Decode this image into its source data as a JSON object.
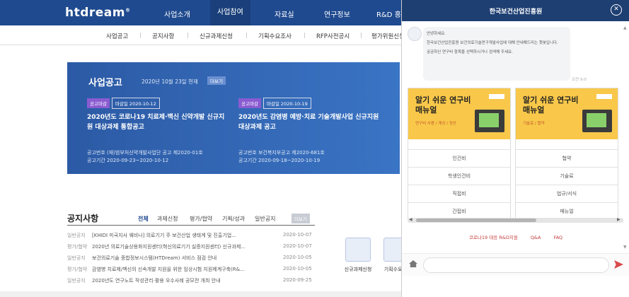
{
  "site": {
    "logo_text": "htdream",
    "logo_mark": "®",
    "nav": [
      "사업소개",
      "사업참여",
      "자료실",
      "연구정보",
      "R&D 홍보"
    ],
    "subnav": [
      "사업공고",
      "공지사항",
      "신규과제신청",
      "기획수요조사",
      "RFP사전공시",
      "평가위원신청"
    ]
  },
  "banner": {
    "title": "사업공고",
    "date": "2020년 10월 23일 현재",
    "more": "더보기",
    "cards": [
      {
        "category": "공고마감",
        "deadline": "마감일 2020-10-12",
        "title": "2020년도 코로나19 치료제·백신 신약개발 신규지원 대상과제 통합공고",
        "number": "공고번호  (재)범부처신약개발사업단 공고 제2020-01호",
        "period": "공고기간  2020-09-23~2020-10-12"
      },
      {
        "category": "공고마감",
        "deadline": "마감일 2020-10-19",
        "title": "2020년도 감염병 예방·치료 기술개발사업 신규지원 대상과제 공고",
        "number": "공고번호  보건복지부공고 제2020-681호",
        "period": "공고기간  2020-09-18~2020-10-19"
      }
    ]
  },
  "notices": {
    "title": "공지사항",
    "tabs": [
      "전체",
      "과제신청",
      "평가/협약",
      "기획/성과",
      "일반공지"
    ],
    "more": "더보기",
    "rows": [
      {
        "cat": "일반공지",
        "text": "[KHIDI 미국지사 웨비나] 의료기기 주 보건산업 생태계 및 진출기업...",
        "date": "2020-10-07"
      },
      {
        "cat": "평가/협약",
        "text": "2020년 의료기술상용화지원센터(혁신의료기기 실증지원센터) 신규과제...",
        "date": "2020-10-07"
      },
      {
        "cat": "일반공지",
        "text": "보건의료기술 종합정보시스템(HTDream) 서비스 점검 안내",
        "date": "2020-10-05"
      },
      {
        "cat": "평가/협약",
        "text": "감염병 치료제/백신의 신속개발 지원을 위한 임상시험 지원제계구축(R&...",
        "date": "2020-10-05"
      },
      {
        "cat": "일반공지",
        "text": "2020년도 연구노트 작성관리·활용 우수사례 공모전 개최 안내",
        "date": "2020-09-25"
      }
    ]
  },
  "quick": [
    {
      "label": "신규과제신청",
      "icon": "document-search-icon"
    },
    {
      "label": "기획수요 조",
      "icon": "bar-chart-icon"
    }
  ],
  "chat": {
    "title": "한국보건산업진흥원",
    "close": "✕",
    "bubble": {
      "greeting": "안녕하세요.",
      "line1": "한국보건산업진흥원 보건의료기술연구개발사업에 대해 안내해드리는 챗봇입니다.",
      "line2": "궁금하신 연구비 항목을 선택하시거나 검색해 주세요."
    },
    "time": "오전 9:0",
    "cards": [
      {
        "title": "알기 쉬운 연구비 매뉴얼",
        "subtitle": "연구비 사용 / 계상 / 정산",
        "items": [
          "인건비",
          "학생인건비",
          "직접비",
          "간접비"
        ]
      },
      {
        "title": "알기 쉬운 연구비 매뉴얼",
        "subtitle": "기술료 / 협약",
        "items": [
          "협약",
          "기술료",
          "법규/서식",
          "매뉴얼"
        ]
      }
    ],
    "links": [
      "코로나19 대응 R&D지원",
      "Q&A",
      "FAQ"
    ],
    "input_placeholder": ""
  }
}
